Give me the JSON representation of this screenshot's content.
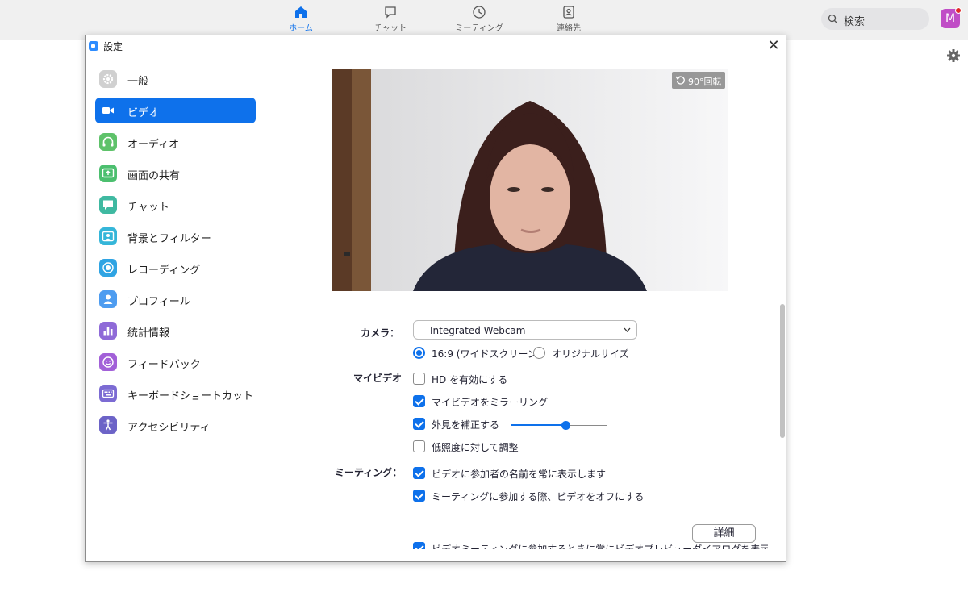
{
  "top_nav": {
    "items": [
      {
        "label": "ホーム",
        "icon": "home-icon",
        "active": true
      },
      {
        "label": "チャット",
        "icon": "chat-icon",
        "active": false
      },
      {
        "label": "ミーティング",
        "icon": "clock-icon",
        "active": false
      },
      {
        "label": "連絡先",
        "icon": "contacts-icon",
        "active": false
      }
    ],
    "search_label": "検索",
    "avatar_initial": "M",
    "accent_color": "#0e71eb"
  },
  "dialog": {
    "title": "設定",
    "close_glyph": "✕"
  },
  "sidebar": {
    "items": [
      {
        "label": "一般",
        "icon": "gear-icon",
        "color": "#d0d0d0",
        "active": false
      },
      {
        "label": "ビデオ",
        "icon": "video-camera-icon",
        "color": "#0e71eb",
        "active": true
      },
      {
        "label": "オーディオ",
        "icon": "headphones-icon",
        "color": "#5ec26a",
        "active": false
      },
      {
        "label": "画面の共有",
        "icon": "share-screen-icon",
        "color": "#4cbf6f",
        "active": false
      },
      {
        "label": "チャット",
        "icon": "chat-bubble-icon",
        "color": "#3fb9a1",
        "active": false
      },
      {
        "label": "背景とフィルター",
        "icon": "background-icon",
        "color": "#35b6d9",
        "active": false
      },
      {
        "label": "レコーディング",
        "icon": "record-icon",
        "color": "#2fa4e3",
        "active": false
      },
      {
        "label": "プロフィール",
        "icon": "profile-icon",
        "color": "#4d9cf0",
        "active": false
      },
      {
        "label": "統計情報",
        "icon": "stats-icon",
        "color": "#8f6ad8",
        "active": false
      },
      {
        "label": "フィードバック",
        "icon": "feedback-icon",
        "color": "#a260d8",
        "active": false
      },
      {
        "label": "キーボードショートカット",
        "icon": "keyboard-icon",
        "color": "#7c6bd3",
        "active": false
      },
      {
        "label": "アクセシビリティ",
        "icon": "accessibility-icon",
        "color": "#6c63c7",
        "active": false
      }
    ]
  },
  "video": {
    "rotate_label": "90°回転",
    "camera_label": "カメラ：",
    "camera_value": "Integrated Webcam",
    "aspect_options": [
      {
        "label": "16:9 (ワイドスクリーン)",
        "selected": true
      },
      {
        "label": "オリジナルサイズ",
        "selected": false
      }
    ],
    "my_video_label": "マイビデオ",
    "my_video_options": [
      {
        "label": "HD を有効にする",
        "checked": false
      },
      {
        "label": "マイビデオをミラーリング",
        "checked": true
      },
      {
        "label": "外見を補正する",
        "checked": true
      },
      {
        "label": "低照度に対して調整",
        "checked": false
      }
    ],
    "touch_up_level": 0.57,
    "meeting_label": "ミーティング：",
    "meeting_options": [
      {
        "label": "ビデオに参加者の名前を常に表示します",
        "checked": true
      },
      {
        "label": "ミーティングに参加する際、ビデオをオフにする",
        "checked": true
      },
      {
        "label": "ビデオミーティングに参加するときに常にビデオプレビューダイアログを表示します",
        "checked": true
      }
    ],
    "details_label": "詳細"
  }
}
